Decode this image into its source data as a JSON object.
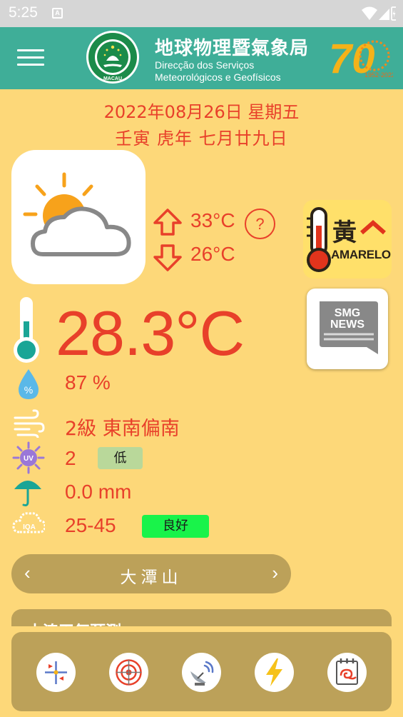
{
  "status_bar": {
    "time": "5:25",
    "notification_badge": "A",
    "icons": [
      "wifi-icon",
      "signal-icon",
      "battery-icon"
    ]
  },
  "app_bar": {
    "title_zh": "地球物理暨氣象局",
    "title_pt_line1": "Direcção dos Serviços",
    "title_pt_line2": "Meteorológicos e Geofísicos",
    "emblem_text": "MACAU",
    "anniversary_number": "70",
    "anniversary_years": "1952-2022"
  },
  "date": {
    "gregorian": "2022年08月26日 星期五",
    "lunar": "壬寅 虎年 七月廿九日"
  },
  "forecast": {
    "icon": "partly-cloudy-icon",
    "high": "33°C",
    "low": "26°C",
    "help": "?"
  },
  "warning": {
    "label_zh": "黃",
    "label_pt": "AMARELO"
  },
  "news": {
    "line1": "SMG",
    "line2": "NEWS"
  },
  "current": {
    "temperature": "28.3°C",
    "humidity": "87 %",
    "wind": "2級 東南偏南",
    "uv_index": "2",
    "uv_level": "低",
    "uv_icon_label": "UV",
    "rainfall": "0.0 mm",
    "aqi": "25-45",
    "aqi_level": "良好",
    "aqi_icon_label": "IQA"
  },
  "station": {
    "name": "大潭山",
    "prev": "‹",
    "next": "›"
  },
  "next_section_title": "本澳天氣預測",
  "colors": {
    "background": "#fdd879",
    "app_bar": "#3fae98",
    "accent_red": "#e8402a",
    "card_tan": "#bca159",
    "uv_badge": "#b9d89a",
    "aqi_badge": "#19f34a"
  },
  "bottom_tools": [
    {
      "icon": "wind-compass-icon"
    },
    {
      "icon": "radar-icon"
    },
    {
      "icon": "satellite-dish-icon"
    },
    {
      "icon": "lightning-icon"
    },
    {
      "icon": "typhoon-calendar-icon"
    }
  ]
}
